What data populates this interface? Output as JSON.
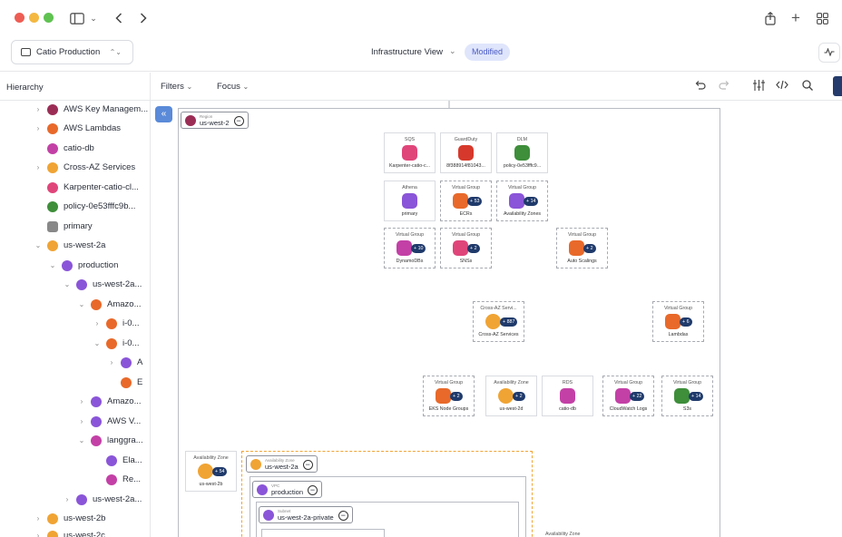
{
  "window": {
    "controls": [
      "close",
      "minimize",
      "maximize"
    ],
    "toolbar_icons": [
      "sidebar-toggle-icon",
      "chevron-down-icon",
      "back-icon",
      "forward-icon",
      "share-icon",
      "plus-icon",
      "grid-icon"
    ]
  },
  "header": {
    "workspace": "Catio Production",
    "view_title": "Infrastructure View",
    "status_badge": "Modified"
  },
  "sidebar": {
    "title": "Hierarchy",
    "items": [
      {
        "label": "AWS Key Managem...",
        "color": "#9b2d55"
      },
      {
        "label": "AWS Lambdas",
        "color": "#e8692a"
      },
      {
        "label": "catio-db",
        "color": "#c340a6"
      },
      {
        "label": "Cross-AZ Services",
        "color": "#f0a434"
      },
      {
        "label": "Karpenter-catio-cl...",
        "color": "#e0457a"
      },
      {
        "label": "policy-0e53fffc9b...",
        "color": "#3e8e3a"
      },
      {
        "label": "primary",
        "color": "#888888"
      },
      {
        "label": "us-west-2a",
        "color": "#f0a434"
      },
      {
        "label": "production",
        "color": "#8a55d8"
      },
      {
        "label": "us-west-2a...",
        "color": "#8a55d8"
      },
      {
        "label": "Amazo...",
        "color": "#e8692a"
      },
      {
        "label": "i-0...",
        "color": "#e8692a"
      },
      {
        "label": "i-0...",
        "color": "#e8692a"
      },
      {
        "label": "A",
        "color": "#8a55d8"
      },
      {
        "label": "E",
        "color": "#e8692a"
      },
      {
        "label": "Amazo...",
        "color": "#8a55d8"
      },
      {
        "label": "AWS V...",
        "color": "#8a55d8"
      },
      {
        "label": "langgra...",
        "color": "#c340a6"
      },
      {
        "label": "Ela...",
        "color": "#8a55d8"
      },
      {
        "label": "Re...",
        "color": "#c340a6"
      },
      {
        "label": "us-west-2a...",
        "color": "#8a55d8"
      },
      {
        "label": "us-west-2b",
        "color": "#f0a434"
      },
      {
        "label": "us-west-2c",
        "color": "#f0a434"
      }
    ]
  },
  "filterbar": {
    "filters_label": "Filters",
    "focus_label": "Focus",
    "icons": [
      "undo-icon",
      "redo-icon",
      "sliders-icon",
      "code-icon",
      "search-icon"
    ]
  },
  "canvas": {
    "region": {
      "small": "Region",
      "name": "us-west-2"
    },
    "nodes": [
      {
        "title": "SQS",
        "label": "Karpenter-catio-c...",
        "color": "#e0457a"
      },
      {
        "title": "GuardDuty",
        "label": "8f388914f81043...",
        "color": "#d6392b"
      },
      {
        "title": "DLM",
        "label": "policy-0e53fffc9...",
        "color": "#3e8e3a"
      },
      {
        "title": "Athena",
        "label": "primary",
        "color": "#8a55d8"
      },
      {
        "title": "Virtual Group",
        "label": "ECRs",
        "count": "+ 53",
        "color": "#e8692a"
      },
      {
        "title": "Virtual Group",
        "label": "Availability Zones",
        "count": "+ 14",
        "color": "#8a55d8"
      },
      {
        "title": "Virtual Group",
        "label": "DynamoDBs",
        "count": "+ 10",
        "color": "#c340a6"
      },
      {
        "title": "Virtual Group",
        "label": "SNSs",
        "count": "+ 2",
        "color": "#e0457a"
      },
      {
        "title": "Virtual Group",
        "label": "Auto Scalings",
        "count": "+ 2",
        "color": "#e8692a"
      },
      {
        "title": "Cross-AZ Servi...",
        "label": "Cross-AZ Services",
        "count": "+ 887",
        "color": "#f0a434"
      },
      {
        "title": "Virtual Group",
        "label": "Lambdas",
        "count": "+ 6",
        "color": "#e8692a"
      },
      {
        "title": "Virtual Group",
        "label": "EKS Node Groups",
        "count": "+ 2",
        "color": "#e8692a"
      },
      {
        "title": "Availability Zone",
        "label": "us-west-2d",
        "count": "+ 2",
        "color": "#f0a434"
      },
      {
        "title": "RDS",
        "label": "catio-db",
        "color": "#c340a6"
      },
      {
        "title": "Virtual Group",
        "label": "CloudWatch Logs",
        "count": "+ 22",
        "color": "#c340a6"
      },
      {
        "title": "Virtual Group",
        "label": "S3s",
        "count": "+ 14",
        "color": "#3e8e3a"
      },
      {
        "title": "Availability Zone",
        "label": "us-west-2b",
        "count": "+ 54",
        "color": "#f0a434"
      }
    ],
    "az_frame": {
      "small": "Availability Zone",
      "name": "us-west-2a"
    },
    "vpc_frame": {
      "small": "VPC",
      "name": "production"
    },
    "subnet_frame": {
      "small": "Subnet",
      "name": "us-west-2a-private"
    },
    "bottom_label": "Availability Zone"
  }
}
